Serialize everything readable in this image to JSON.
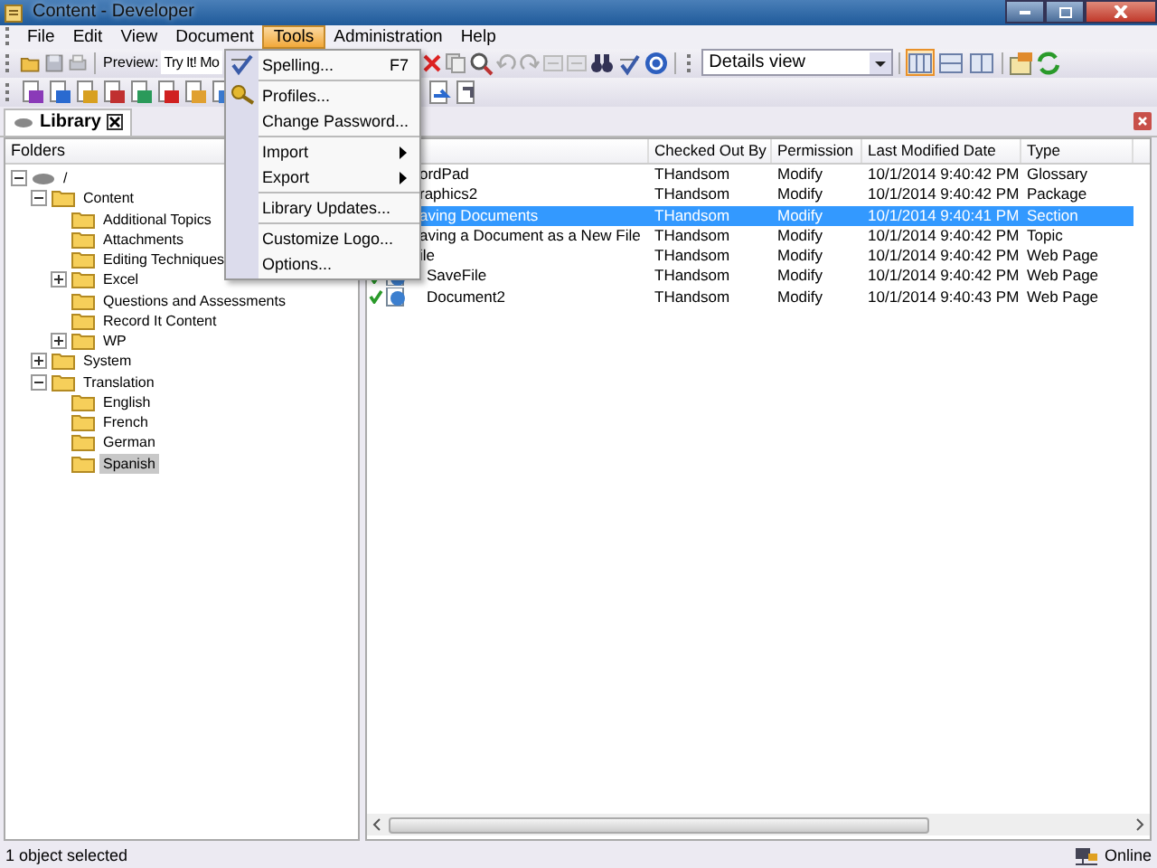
{
  "window": {
    "title": "Content - Developer"
  },
  "menu_bar": [
    {
      "label": "File",
      "selected": false
    },
    {
      "label": "Edit",
      "selected": false
    },
    {
      "label": "View",
      "selected": false
    },
    {
      "label": "Document",
      "selected": false
    },
    {
      "label": "Tools",
      "selected": true
    },
    {
      "label": "Administration",
      "selected": false
    },
    {
      "label": "Help",
      "selected": false
    }
  ],
  "tools_menu": [
    {
      "kind": "item",
      "label": "Spelling...",
      "shortcut": "F7"
    },
    {
      "kind": "separator"
    },
    {
      "kind": "item",
      "label": "Profiles..."
    },
    {
      "kind": "item",
      "label": "Change Password..."
    },
    {
      "kind": "separator"
    },
    {
      "kind": "submenu",
      "label": "Import"
    },
    {
      "kind": "submenu",
      "label": "Export"
    },
    {
      "kind": "separator"
    },
    {
      "kind": "item",
      "label": "Library Updates..."
    },
    {
      "kind": "separator"
    },
    {
      "kind": "item",
      "label": "Customize Logo..."
    },
    {
      "kind": "item",
      "label": "Options..."
    }
  ],
  "toolbar": {
    "preview_label": "Preview:",
    "preview_value": "Try It! Mo",
    "view_combo": "Details view",
    "view_buttons": [
      {
        "selected": true
      },
      {
        "selected": false
      },
      {
        "selected": false
      }
    ]
  },
  "library_tab": {
    "label": "Library"
  },
  "folders": {
    "header": "Folders",
    "tree": [
      {
        "label": "/",
        "expanded": true,
        "selected": false,
        "children": [
          {
            "label": "Content",
            "expanded": true,
            "selected": false,
            "children": [
              {
                "label": "Additional Topics",
                "selected": false
              },
              {
                "label": "Attachments",
                "selected": false
              },
              {
                "label": "Editing Techniques",
                "selected": false
              },
              {
                "label": "Excel",
                "expanded": false,
                "selected": false
              },
              {
                "label": "Questions and Assessments",
                "selected": false
              },
              {
                "label": "Record It Content",
                "selected": false
              },
              {
                "label": "WP",
                "expanded": false,
                "selected": false
              }
            ]
          },
          {
            "label": "System",
            "expanded": false,
            "selected": false
          },
          {
            "label": "Translation",
            "expanded": true,
            "selected": false,
            "children": [
              {
                "label": "English",
                "selected": false
              },
              {
                "label": "French",
                "selected": false
              },
              {
                "label": "German",
                "selected": false
              },
              {
                "label": "Spanish",
                "selected": true
              }
            ]
          }
        ]
      }
    ]
  },
  "table": {
    "columns": [
      "Checked Out By",
      "Permission",
      "Last Modified Date",
      "Type"
    ],
    "rows": [
      {
        "name": "ordPad",
        "checked_out_by": "THandsom",
        "permission": "Modify",
        "modified": "10/1/2014 9:40:42 PM",
        "type": "Glossary",
        "selected": false
      },
      {
        "name": "raphics2",
        "checked_out_by": "THandsom",
        "permission": "Modify",
        "modified": "10/1/2014 9:40:42 PM",
        "type": "Package",
        "selected": false
      },
      {
        "name": "aving Documents",
        "checked_out_by": "THandsom",
        "permission": "Modify",
        "modified": "10/1/2014 9:40:41 PM",
        "type": "Section",
        "selected": true
      },
      {
        "name": "aving a Document as a New File",
        "checked_out_by": "THandsom",
        "permission": "Modify",
        "modified": "10/1/2014 9:40:42 PM",
        "type": "Topic",
        "selected": false
      },
      {
        "name": "ile",
        "checked_out_by": "THandsom",
        "permission": "Modify",
        "modified": "10/1/2014 9:40:42 PM",
        "type": "Web Page",
        "selected": false
      },
      {
        "name": "SaveFile",
        "checked_out_by": "THandsom",
        "permission": "Modify",
        "modified": "10/1/2014 9:40:42 PM",
        "type": "Web Page",
        "selected": false,
        "checked": true
      },
      {
        "name": "Document2",
        "checked_out_by": "THandsom",
        "permission": "Modify",
        "modified": "10/1/2014 9:40:43 PM",
        "type": "Web Page",
        "selected": false,
        "checked": true
      }
    ]
  },
  "status_bar": {
    "text": "1 object selected",
    "connection": "Online"
  }
}
